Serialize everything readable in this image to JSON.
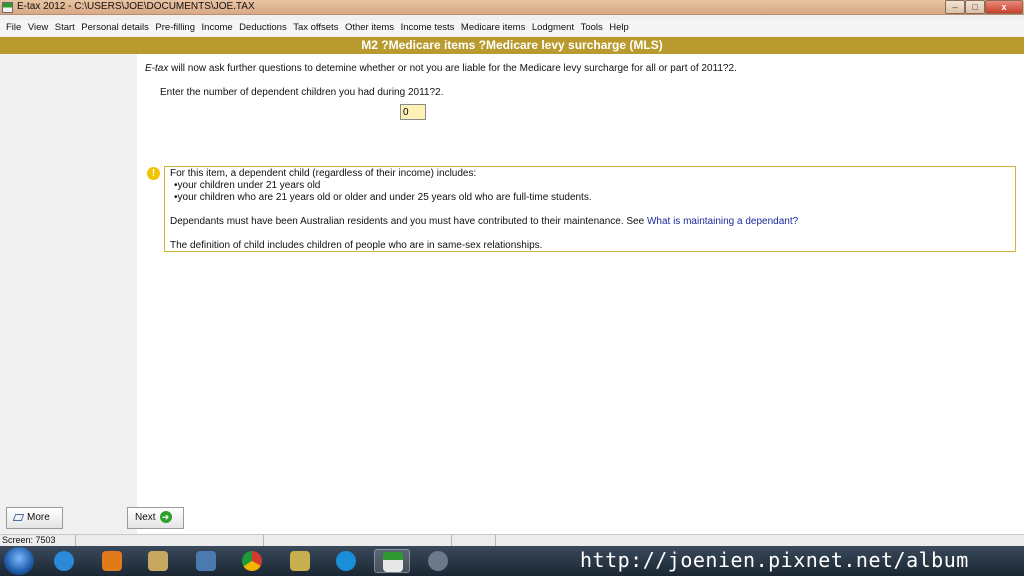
{
  "window": {
    "title": "E-tax 2012 - C:\\USERS\\JOE\\DOCUMENTS\\JOE.TAX",
    "minimize_label": "–",
    "maximize_label": "□",
    "close_label": "x"
  },
  "menu": {
    "items": [
      {
        "label": "File"
      },
      {
        "label": "View"
      },
      {
        "label": "Start"
      },
      {
        "label": "Personal details"
      },
      {
        "label": "Pre-filling"
      },
      {
        "label": "Income"
      },
      {
        "label": "Deductions"
      },
      {
        "label": "Tax offsets"
      },
      {
        "label": "Other items"
      },
      {
        "label": "Income tests"
      },
      {
        "label": "Medicare items"
      },
      {
        "label": "Lodgment"
      },
      {
        "label": "Tools"
      },
      {
        "label": "Help"
      }
    ]
  },
  "header": {
    "title": "M2 ?Medicare items ?Medicare levy surcharge (MLS)"
  },
  "main": {
    "intro_brand": "E-tax",
    "intro_text": " will now ask further questions to detemine whether or not you are liable for the Medicare levy surcharge for all or part of 2011?2.",
    "question": "Enter the number of dependent children you had during 2011?2.",
    "answer_value": "0",
    "warning_icon_glyph": "!",
    "info": {
      "line1": "For this item, a dependent child (regardless of their income) includes:",
      "bullet1": "•your children under 21 years old",
      "bullet2": "•your children who are 21 years old or older and under 25 years old who are full-time students.",
      "line2": "Dependants must have been Australian residents and you must have contributed to their maintenance. See ",
      "link": "What is maintaining a dependant?",
      "line3": "The definition of child includes children of people who are in same-sex relationships."
    }
  },
  "buttons": {
    "more_label": "More",
    "next_label": "Next",
    "next_glyph": "➔"
  },
  "statusbar": {
    "screen": "Screen: 7503"
  },
  "taskbar": {
    "icons": [
      "windows-start",
      "internet-explorer",
      "media-player",
      "file-explorer",
      "maps-app",
      "chrome",
      "folder",
      "skype",
      "e-tax",
      "settings-app"
    ],
    "watermark": "http://joenien.pixnet.net/album"
  },
  "colors": {
    "header_band": "#b89a2e",
    "info_border": "#d2b33c",
    "answer_bg": "#fdf1b8",
    "link": "#1a2a9a"
  }
}
